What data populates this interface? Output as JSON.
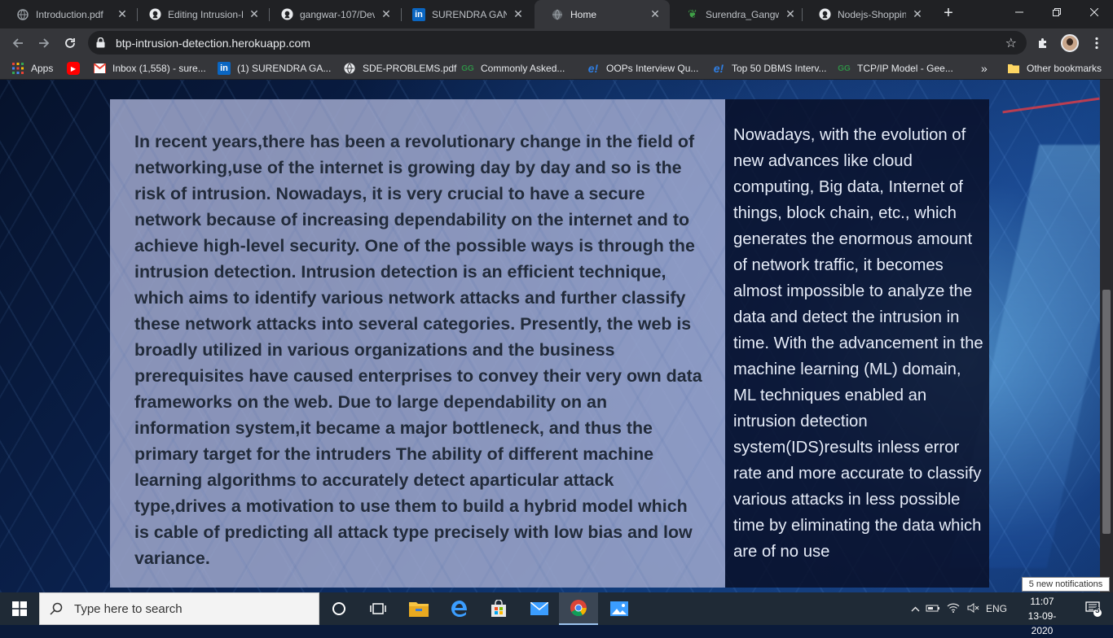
{
  "browser": {
    "tabs": [
      {
        "label": "Introduction.pdf",
        "icon": "globe-icon"
      },
      {
        "label": "Editing Intrusion-D",
        "icon": "github-icon"
      },
      {
        "label": "gangwar-107/Dev",
        "icon": "github-icon"
      },
      {
        "label": "SURENDRA GANG",
        "icon": "linkedin-icon"
      },
      {
        "label": "Home",
        "icon": "globe-icon"
      },
      {
        "label": "Surendra_Gangwa",
        "icon": "leaf-icon"
      },
      {
        "label": "Nodejs-Shopping-",
        "icon": "github-icon"
      }
    ],
    "active_tab_index": 4,
    "url": "btp-intrusion-detection.herokuapp.com",
    "bookmarks": [
      {
        "label": "Apps",
        "icon": "apps-grid-icon"
      },
      {
        "label": "",
        "icon": "youtube-icon"
      },
      {
        "label": "Inbox (1,558) - sure...",
        "icon": "gmail-icon"
      },
      {
        "label": "(1) SURENDRA GA...",
        "icon": "linkedin-icon"
      },
      {
        "label": "SDE-PROBLEMS.pdf",
        "icon": "globe-icon"
      },
      {
        "label": "Commonly Asked...",
        "icon": "gfg-icon"
      },
      {
        "label": "OOPs Interview Qu...",
        "icon": "edureka-icon"
      },
      {
        "label": "Top 50 DBMS Interv...",
        "icon": "edureka-icon"
      },
      {
        "label": "TCP/IP Model - Gee...",
        "icon": "gfg-icon"
      }
    ],
    "more_bookmarks": "»",
    "other_bookmarks": "Other bookmarks"
  },
  "page": {
    "left_paragraph": "In recent years,there has been a revolutionary change in the field of networking,use of the internet is growing day by day and so is the risk of intrusion. Nowadays, it is very crucial to have a secure network because of increasing dependability on the internet and to achieve high-level security. One of the possible ways is through the intrusion detection. Intrusion detection is an efficient technique, which aims to identify various network attacks and further classify these network attacks into several categories. Presently, the web is broadly utilized in various organizations and the business prerequisites have caused enterprises to convey their very own data frameworks on the web. Due to large dependability on an information system,it became a major bottleneck, and thus the primary target for the intruders The ability of different machine learning algorithms to accurately detect aparticular attack type,drives a motivation to use them to build a hybrid model which is cable of predicting all attack type precisely with low bias and low variance.",
    "right_paragraph": "Nowadays, with the evolution of new advances like cloud computing, Big data, Internet of things, block chain, etc., which generates the enormous amount of network traffic, it becomes almost impossible to analyze the data and detect the intrusion in time. With the advancement in the machine learning (ML) domain, ML techniques enabled an intrusion detection system(IDS)results inless error rate and more accurate to classify various attacks in less possible time by eliminating the data which are of no use"
  },
  "taskbar": {
    "search_placeholder": "Type here to search",
    "language": "ENG",
    "time": "11:07",
    "date": "13-09-2020",
    "notification_count": "5",
    "notification_tip": "5 new notifications"
  }
}
